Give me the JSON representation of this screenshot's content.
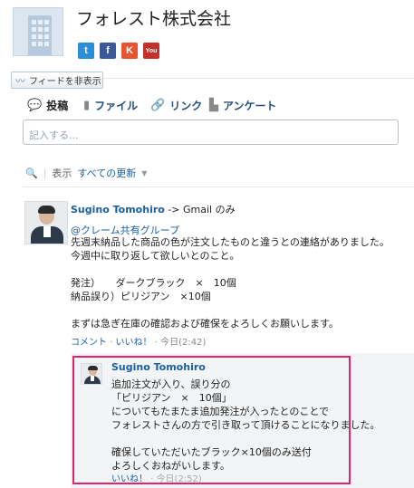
{
  "header": {
    "company_name": "フォレスト株式会社",
    "social": [
      {
        "icon": "twitter-icon",
        "glyph": "t",
        "color": "#2a8fd6"
      },
      {
        "icon": "facebook-icon",
        "glyph": "f",
        "color": "#3b5998"
      },
      {
        "icon": "klout-icon",
        "glyph": "K",
        "color": "#e8542f"
      },
      {
        "icon": "youtube-icon",
        "glyph": "You",
        "color": "#c4302b"
      }
    ]
  },
  "feed_toggle": {
    "label": "フィードを非表示"
  },
  "publisher": {
    "tabs": [
      {
        "label": "投稿",
        "icon": "speech-bubble-icon"
      },
      {
        "label": "ファイル",
        "icon": "file-icon"
      },
      {
        "label": "リンク",
        "icon": "link-icon"
      },
      {
        "label": "アンケート",
        "icon": "poll-icon"
      }
    ],
    "placeholder": "記入する..."
  },
  "filter": {
    "label": "表示",
    "selected": "すべての更新"
  },
  "post": {
    "author": "Sugino Tomohiro",
    "recipient": "-> Gmail のみ",
    "mention": "@クレーム共有グループ",
    "body": [
      "先週末納品した商品の色が注文したものと違うとの連絡がありました。",
      "今週中に取り返して欲しいとのこと。",
      "",
      "発注）　　ダークブラック　×　10個",
      "納品誤り）ピリジアン　×10個",
      "",
      "まずは急ぎ在庫の確認および確保をよろしくお願いします。"
    ],
    "actions": {
      "comment": "コメント",
      "like": "いいね！",
      "time": "今日(2:42)"
    }
  },
  "comment": {
    "author": "Sugino Tomohiro",
    "body": [
      "追加注文が入り、誤り分の",
      "「ピリジアン　×　10個」",
      "についてもたまたま追加発注が入ったとのことで",
      "フォレストさんの方で引き取って頂けることになりました。",
      "",
      "確保していただいたブラック×10個のみ送付",
      "よろしくおねがいします。"
    ],
    "actions": {
      "like": "いいね！",
      "time": "今日(2:52)"
    }
  }
}
